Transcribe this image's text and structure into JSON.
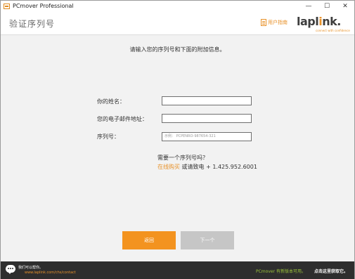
{
  "window": {
    "title": "PCmover Professional",
    "controls": {
      "minimize": "—",
      "maximize": "☐",
      "close": "✕"
    }
  },
  "header": {
    "page_title": "验证序列号",
    "guide_label": "用户指南",
    "logo_text": "lapl",
    "logo_accent": "i",
    "logo_text_end": "nk.",
    "logo_tagline": "connect with confidence"
  },
  "main": {
    "instruction": "请输入您的序列号和下面的附加信息。",
    "fields": {
      "name_label": "你的姓名：",
      "name_value": "",
      "email_label": "您的电子邮件地址：",
      "email_value": "",
      "serial_label": "序列号：",
      "serial_placeholder": "示例： PCPENRO-987654-321"
    },
    "need_serial": "需要一个序列号吗？",
    "buy_link": "在线购买",
    "buy_rest": " 或请致电 + 1.425.952.6001"
  },
  "buttons": {
    "back": "返回",
    "next": "下一个"
  },
  "footer": {
    "help": "我们可以帮你。",
    "contact": "www.laplink.com/chs/contact",
    "update_available": "PCmover 有新版本可用。",
    "update_action": "点击这里获取它。"
  },
  "colors": {
    "accent": "#f3931f",
    "disabled_button": "#c6c6c6",
    "footer_bg": "#2e2e2e",
    "update_green": "#9bc43a"
  }
}
